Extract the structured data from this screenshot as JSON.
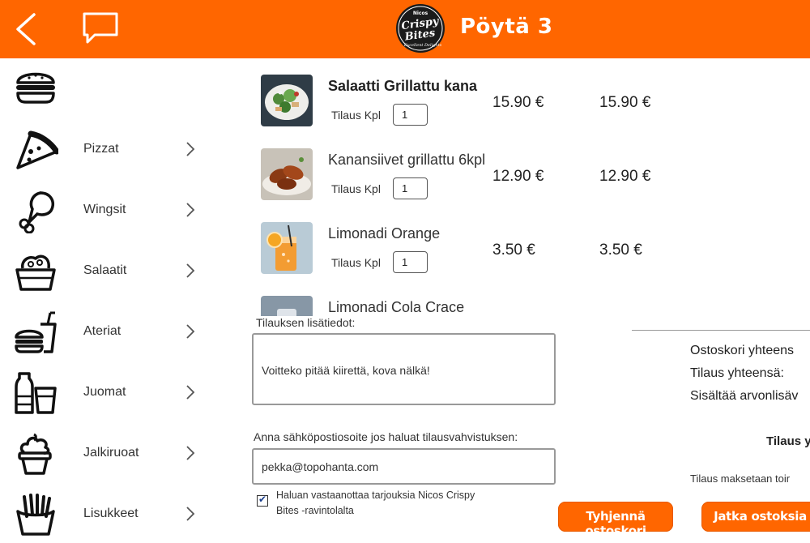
{
  "header": {
    "title": "Pöytä 3",
    "logo_text": [
      "Nicos",
      "Crispy",
      "Bites",
      "Excellent Delights"
    ],
    "accent_color": "#ff6600",
    "back_icon": "chevron-left-icon",
    "chat_icon": "chat-bubble-icon"
  },
  "sidebar": {
    "items": [
      {
        "label": "",
        "icon": "burger-icon"
      },
      {
        "label": "Pizzat",
        "icon": "pizza-slice-icon"
      },
      {
        "label": "Wingsit",
        "icon": "chicken-leg-icon"
      },
      {
        "label": "Salaatit",
        "icon": "salad-bowl-icon"
      },
      {
        "label": "Ateriat",
        "icon": "meal-combo-icon"
      },
      {
        "label": "Juomat",
        "icon": "drinks-icon"
      },
      {
        "label": "Jalkiruoat",
        "icon": "ice-cream-icon"
      },
      {
        "label": "Lisukkeet",
        "icon": "fries-icon"
      }
    ]
  },
  "cart": {
    "qty_label": "Tilaus Kpl",
    "items": [
      {
        "name": "Salaatti Grillattu kana",
        "qty": "1",
        "price": "15.90 €",
        "total": "15.90 €"
      },
      {
        "name": "Kanansiivet grillattu 6kpl",
        "qty": "1",
        "price": "12.90 €",
        "total": "12.90 €"
      },
      {
        "name": "Limonadi Orange",
        "qty": "1",
        "price": "3.50 €",
        "total": "3.50 €"
      },
      {
        "name": "Limonadi Cola Crace",
        "qty": "",
        "price": "",
        "total": ""
      }
    ]
  },
  "notes": {
    "label": "Tilauksen lisätiedot:",
    "value": "Voitteko pitää kiirettä, kova nälkä!"
  },
  "email": {
    "label": "Anna sähköpostiosoite jos haluat tilausvahvistuksen:",
    "value": "pekka@topohanta.com"
  },
  "offers": {
    "checked": true,
    "text": "Haluan vastaanottaa tarjouksia Nicos Crispy Bites -ravintolalta"
  },
  "summary": {
    "cart_total_label": "Ostoskori yhteens",
    "order_total_label": "Tilaus yhteensä:",
    "vat_label": "Sisältää arvonlisäv",
    "order_bold_label": "Tilaus y",
    "payment_note": "Tilaus maksetaan toir"
  },
  "buttons": {
    "clear_label": "Tyhjennä ostoskori",
    "continue_label": "Jatka ostoksia"
  }
}
